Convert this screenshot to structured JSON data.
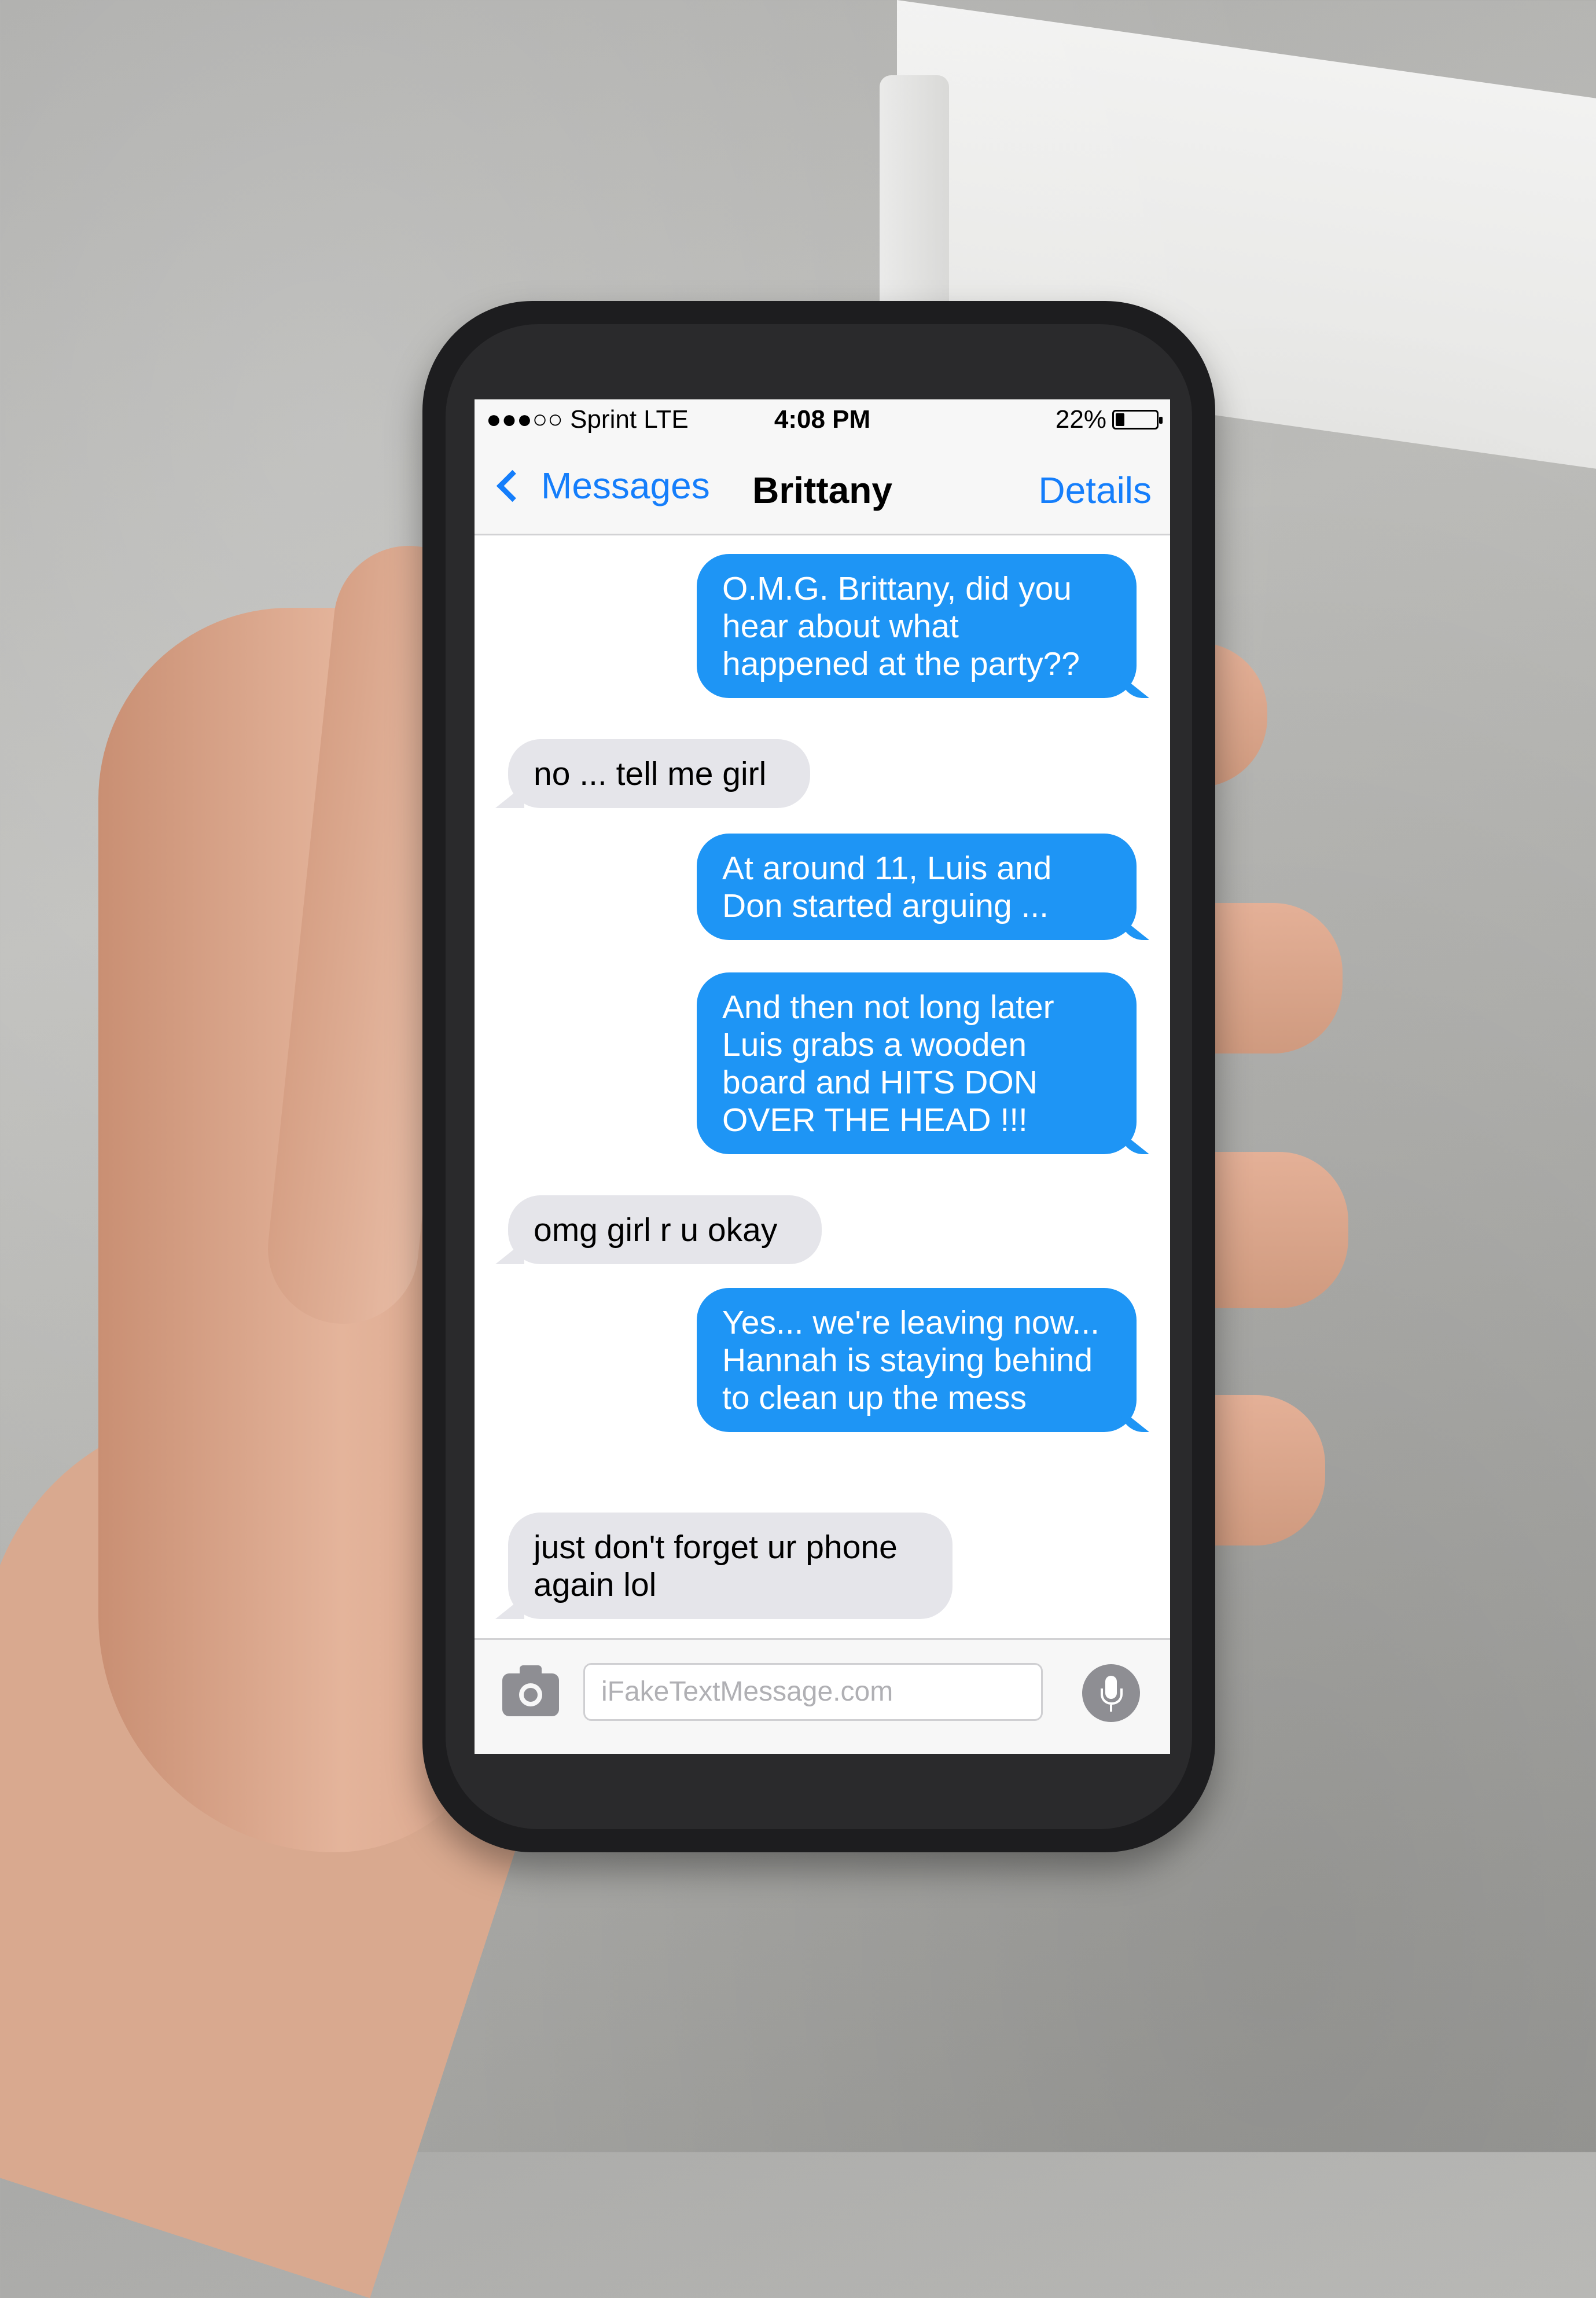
{
  "status_bar": {
    "carrier": "●●●○○ Sprint  LTE",
    "time": "4:08 PM",
    "battery_text": "22%",
    "battery_level": 0.22
  },
  "nav": {
    "back_label": "Messages",
    "title": "Brittany",
    "details_label": "Details"
  },
  "messages": [
    {
      "type": "sent",
      "text": "O.M.G. Brittany, did you hear about what happened at the party??"
    },
    {
      "type": "received",
      "text": "no ... tell me girl"
    },
    {
      "type": "sent",
      "text": "At around 11, Luis and Don started arguing ..."
    },
    {
      "type": "sent",
      "text": "And then not long later Luis grabs a wooden board and HITS DON OVER THE HEAD !!!"
    },
    {
      "type": "received",
      "text": "omg girl r u okay"
    },
    {
      "type": "sent",
      "text": "Yes... we're leaving now... Hannah is staying behind to clean up the mess"
    },
    {
      "type": "received",
      "text": "just don't forget ur phone again lol"
    }
  ],
  "input": {
    "placeholder": "iFakeTextMessage.com"
  },
  "colors": {
    "sent_bubble": "#1e95f5",
    "received_bubble": "#e5e5ea",
    "accent": "#157efb"
  },
  "icons": [
    "camera-icon",
    "microphone-icon",
    "chevron-left-icon",
    "battery-icon"
  ]
}
